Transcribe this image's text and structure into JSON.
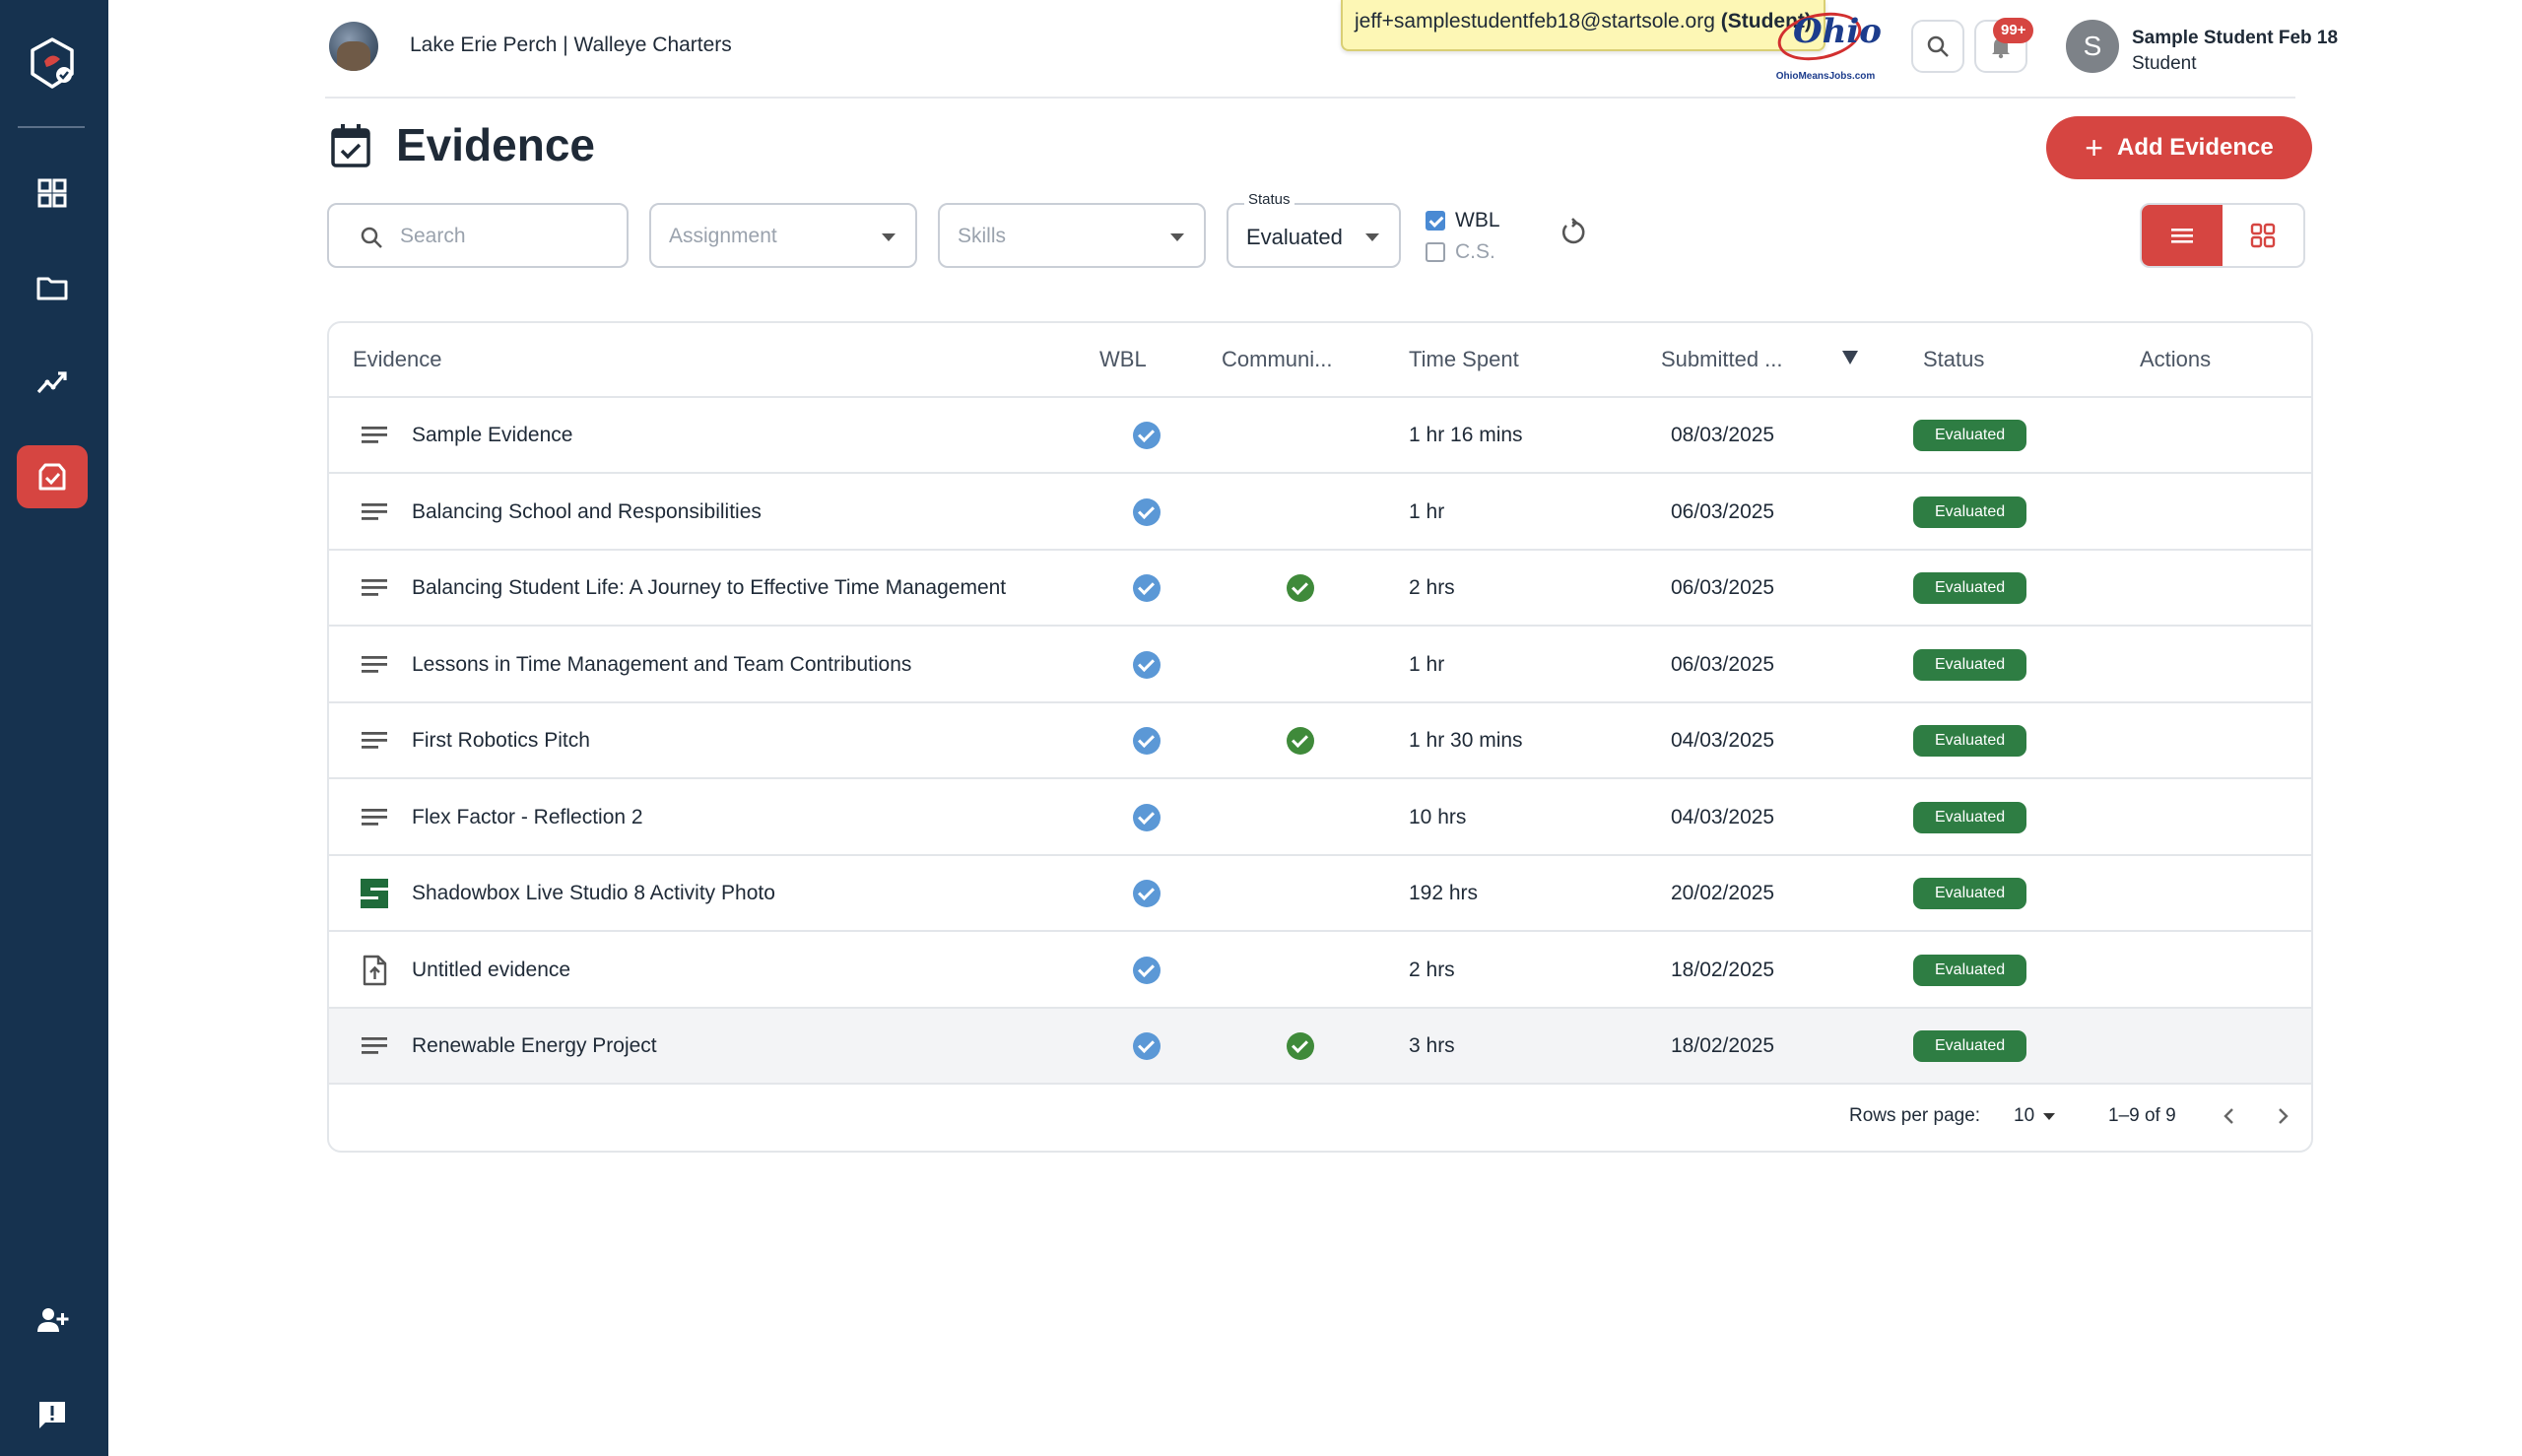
{
  "header": {
    "org_name": "Lake Erie Perch | Walleye Charters",
    "impersonation_email": "jeff+samplestudentfeb18@startsole.org",
    "impersonation_role": "(Student)",
    "partner_logo_word": "Ohio",
    "partner_logo_sub": "OhioMeansJobs.com",
    "notifications_badge": "99+",
    "user_initial": "S",
    "user_name": "Sample Student Feb 18",
    "user_role": "Student"
  },
  "page": {
    "title": "Evidence",
    "add_button_label": "Add Evidence"
  },
  "filters": {
    "search_placeholder": "Search",
    "assignment_placeholder": "Assignment",
    "skills_placeholder": "Skills",
    "status_label": "Status",
    "status_value": "Evaluated",
    "wbl_label": "WBL",
    "wbl_checked": true,
    "cs_label": "C.S.",
    "cs_checked": false
  },
  "table": {
    "headers": {
      "evidence": "Evidence",
      "wbl": "WBL",
      "community": "Communi...",
      "time_spent": "Time Spent",
      "submitted": "Submitted ...",
      "status": "Status",
      "actions": "Actions"
    },
    "rows": [
      {
        "title": "Sample Evidence",
        "icon": "text-lines-icon",
        "wbl": true,
        "community": false,
        "time": "1 hr 16 mins",
        "date": "08/03/2025",
        "status": "Evaluated"
      },
      {
        "title": "Balancing School and Responsibilities",
        "icon": "text-lines-icon",
        "wbl": true,
        "community": false,
        "time": "1 hr",
        "date": "06/03/2025",
        "status": "Evaluated"
      },
      {
        "title": "Balancing Student Life: A Journey to Effective Time Management",
        "icon": "text-lines-icon",
        "wbl": true,
        "community": true,
        "time": "2 hrs",
        "date": "06/03/2025",
        "status": "Evaluated"
      },
      {
        "title": "Lessons in Time Management and Team Contributions",
        "icon": "text-lines-icon",
        "wbl": true,
        "community": false,
        "time": "1 hr",
        "date": "06/03/2025",
        "status": "Evaluated"
      },
      {
        "title": "First Robotics Pitch",
        "icon": "text-lines-icon",
        "wbl": true,
        "community": true,
        "time": "1 hr 30 mins",
        "date": "04/03/2025",
        "status": "Evaluated"
      },
      {
        "title": "Flex Factor - Reflection 2",
        "icon": "text-lines-icon",
        "wbl": true,
        "community": false,
        "time": "10 hrs",
        "date": "04/03/2025",
        "status": "Evaluated"
      },
      {
        "title": "Shadowbox Live Studio 8 Activity Photo",
        "icon": "s-logo-icon",
        "wbl": true,
        "community": false,
        "time": "192 hrs",
        "date": "20/02/2025",
        "status": "Evaluated"
      },
      {
        "title": "Untitled evidence",
        "icon": "file-upload-icon",
        "wbl": true,
        "community": false,
        "time": "2 hrs",
        "date": "18/02/2025",
        "status": "Evaluated"
      },
      {
        "title": "Renewable Energy Project",
        "icon": "text-lines-icon",
        "wbl": true,
        "community": true,
        "time": "3 hrs",
        "date": "18/02/2025",
        "status": "Evaluated"
      }
    ]
  },
  "pagination": {
    "rows_per_page_label": "Rows per page:",
    "rows_per_page_value": "10",
    "range": "1–9 of 9"
  },
  "colors": {
    "sidebar": "#16324f",
    "accent": "#d64541",
    "status_green": "#2e7d43",
    "wbl_blue": "#5b98d6"
  }
}
